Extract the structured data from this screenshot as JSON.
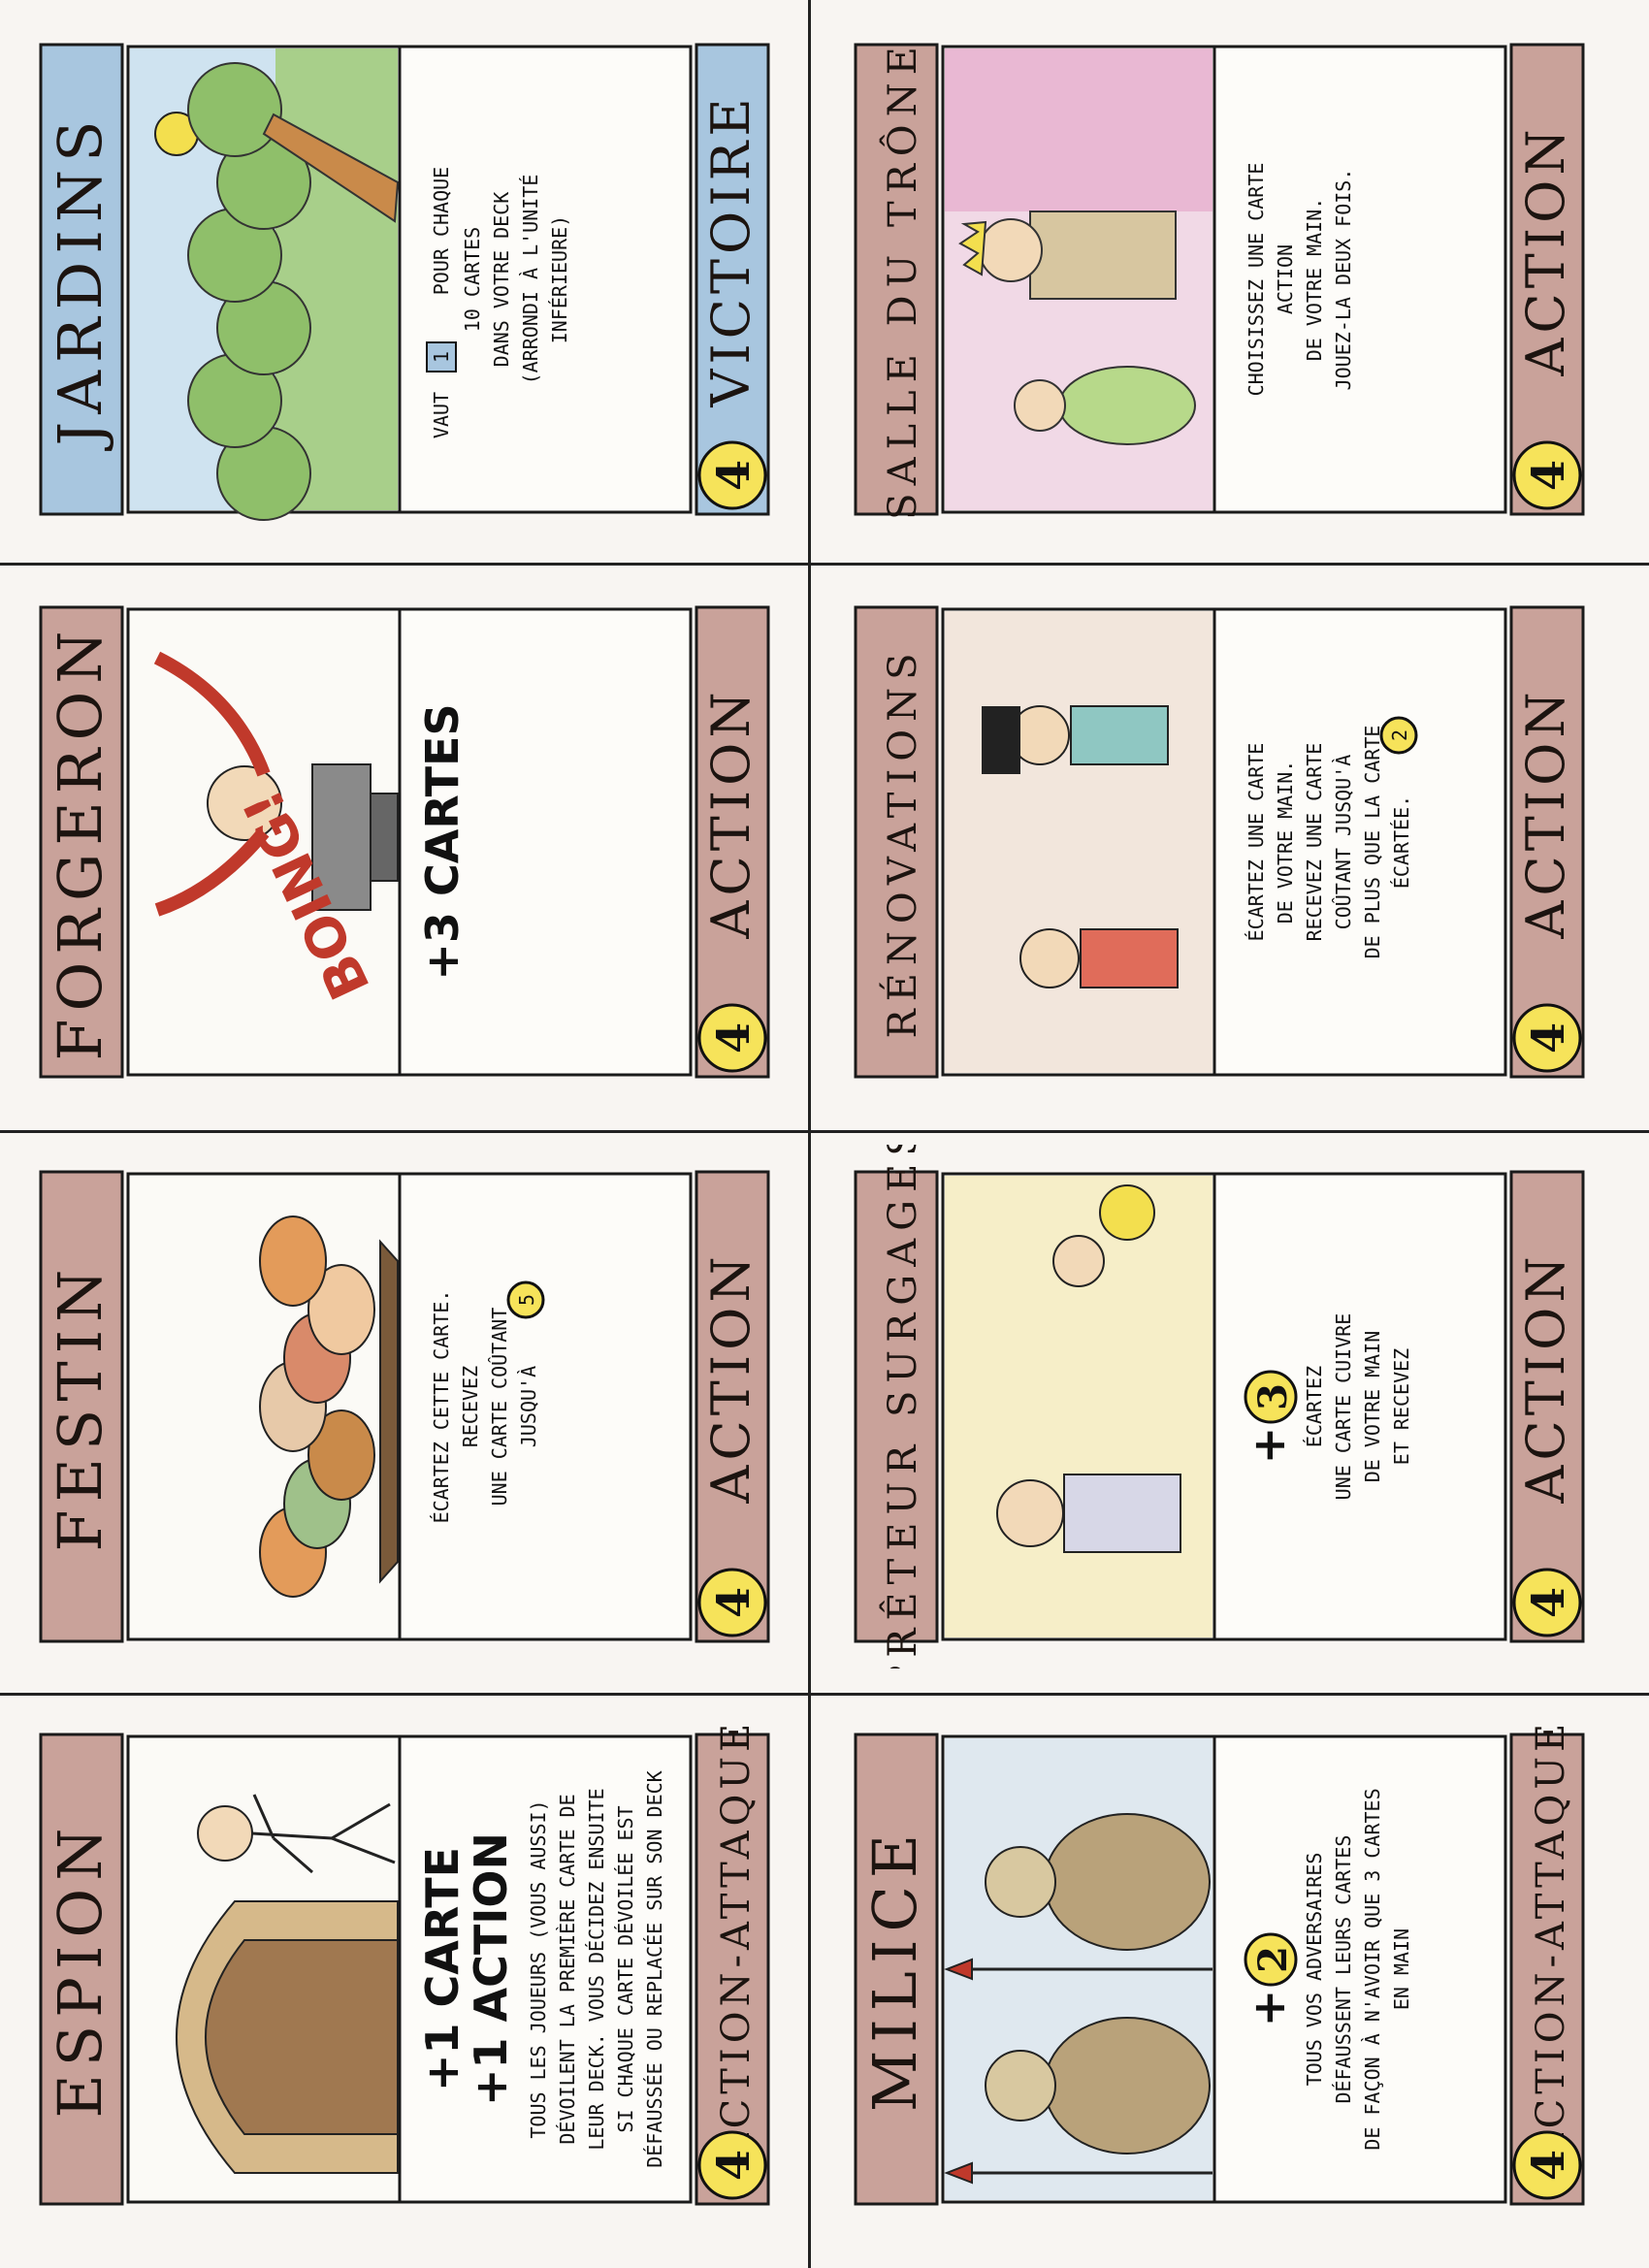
{
  "sheet": {
    "cards": [
      {
        "id": "espion",
        "title": "ESPION",
        "type": "ACTION-ATTAQUE",
        "cost": "4",
        "bonus": [
          "+1 CARTE",
          "+1 ACTION"
        ],
        "text": [
          "TOUS LES JOUEURS (VOUS AUSSI)",
          "DÉVOILENT LA PREMIÈRE CARTE DE",
          "LEUR DECK. VOUS DÉCIDEZ ENSUITE",
          "SI CHAQUE CARTE DÉVOILÉE EST",
          "DÉFAUSSÉE OU REPLACÉE SUR SON DECK"
        ],
        "illustration": "spy-doorway-illustration",
        "banner_color": "#c9a29a"
      },
      {
        "id": "festin",
        "title": "FESTIN",
        "type": "ACTION",
        "cost": "4",
        "bonus": [],
        "text": [
          "ÉCARTEZ CETTE CARTE.",
          "RECEVEZ",
          "UNE CARTE COÛTANT",
          "JUSQU'À"
        ],
        "text_coin": "5",
        "illustration": "feast-food-illustration",
        "banner_color": "#c9a29a"
      },
      {
        "id": "forgeron",
        "title": "FORGERON",
        "type": "ACTION",
        "cost": "4",
        "bonus": [
          "+3 CARTES"
        ],
        "text": [],
        "art_text": "BOING!",
        "illustration": "blacksmith-anvil-illustration",
        "banner_color": "#c9a29a"
      },
      {
        "id": "jardins",
        "title": "JARDINS",
        "type": "VICTOIRE",
        "cost": "4",
        "bonus": [],
        "text_pre": "VAUT",
        "text_box": "1",
        "text_post": "POUR CHAQUE",
        "text": [
          "10 CARTES",
          "DANS VOTRE DECK",
          "(ARRONDI À L'UNITÉ",
          "INFÉRIEURE)"
        ],
        "illustration": "garden-trees-illustration",
        "banner_color": "#a8c6df"
      },
      {
        "id": "milice",
        "title": "MILICE",
        "type": "ACTION-ATTAQUE",
        "cost": "4",
        "bonus_coin": "2",
        "text": [
          "TOUS VOS ADVERSAIRES",
          "DÉFAUSSENT LEURS CARTES",
          "DE FAÇON À N'AVOIR QUE 3 CARTES",
          "EN MAIN"
        ],
        "illustration": "soldiers-spears-illustration",
        "banner_color": "#c9a29a"
      },
      {
        "id": "preteur",
        "title": "PRÊTEUR SURGAGES",
        "type": "ACTION",
        "cost": "4",
        "bonus_coin": "3",
        "text": [
          "ÉCARTEZ",
          "UNE CARTE CUIVRE",
          "DE VOTRE MAIN",
          "ET RECEVEZ"
        ],
        "illustration": "moneylender-illustration",
        "banner_color": "#c9a29a"
      },
      {
        "id": "renovations",
        "title": "RÉNOVATIONS",
        "type": "ACTION",
        "cost": "4",
        "bonus": [],
        "text": [
          "ÉCARTEZ UNE CARTE",
          "DE VOTRE MAIN.",
          "RECEVEZ UNE CARTE",
          "COÛTANT JUSQU'À",
          "DE PLUS QUE LA CARTE",
          "ÉCARTÉE."
        ],
        "text_coin": "2",
        "illustration": "renovation-workers-illustration",
        "banner_color": "#c9a29a"
      },
      {
        "id": "salle",
        "title": "SALLE DU TRÔNE",
        "type": "ACTION",
        "cost": "4",
        "bonus": [],
        "text": [
          "CHOISISSEZ UNE CARTE",
          "ACTION",
          "DE VOTRE MAIN.",
          "JOUEZ-LA DEUX FOIS."
        ],
        "illustration": "throne-room-illustration",
        "banner_color": "#c9a29a"
      }
    ]
  }
}
